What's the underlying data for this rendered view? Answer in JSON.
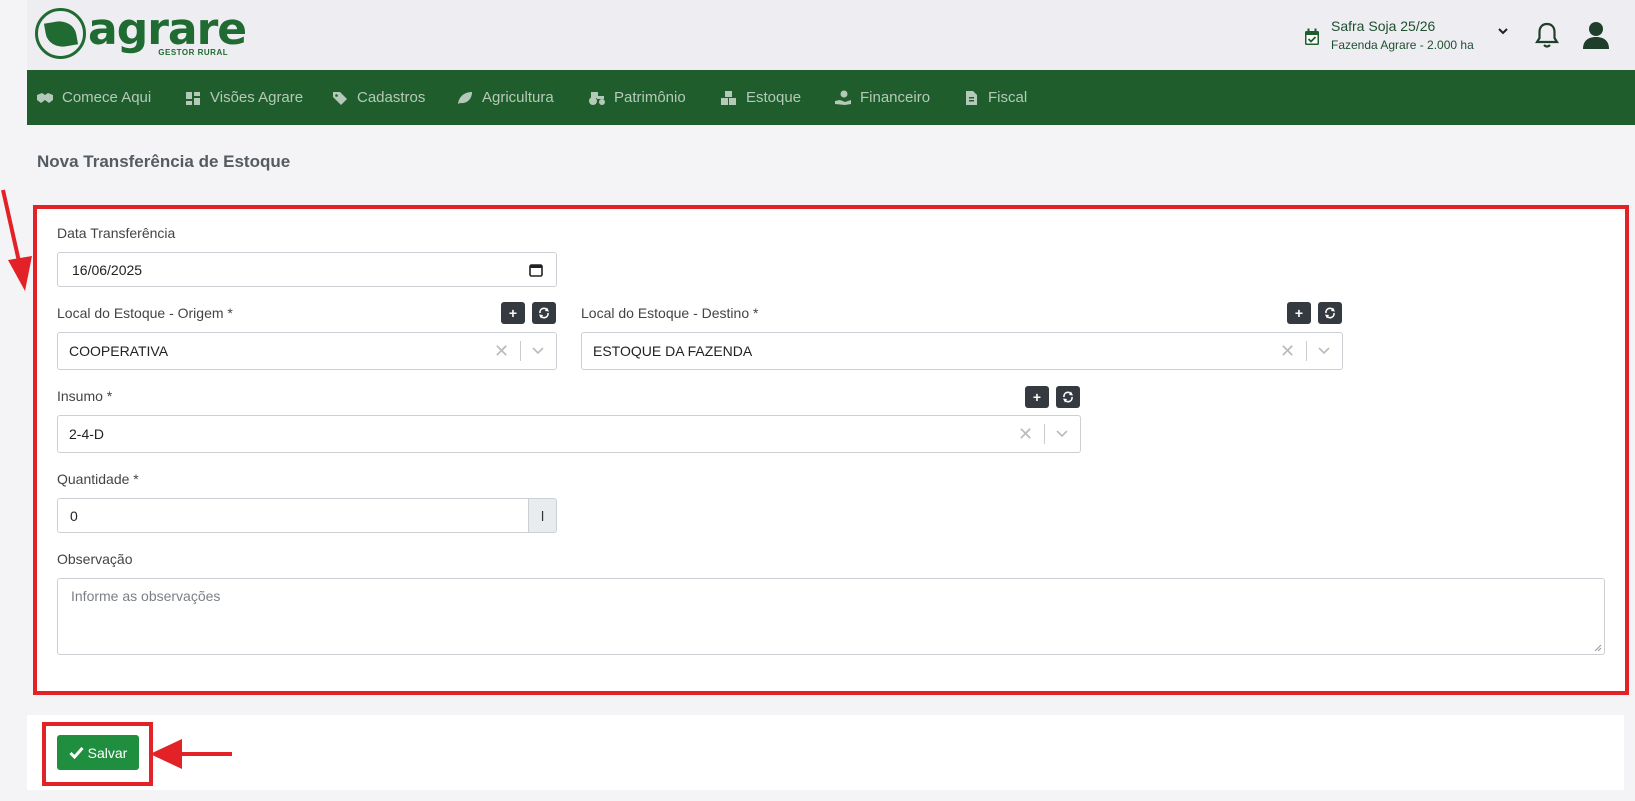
{
  "header": {
    "logo_text": "agrare",
    "logo_subtitle": "GESTOR RURAL",
    "safra_title": "Safra Soja 25/26",
    "safra_subtitle": "Fazenda Agrare - 2.000 ha"
  },
  "nav": {
    "items": [
      {
        "label": "Comece Aqui",
        "icon": "handshake-icon"
      },
      {
        "label": "Visões Agrare",
        "icon": "dashboard-icon"
      },
      {
        "label": "Cadastros",
        "icon": "tag-icon"
      },
      {
        "label": "Agricultura",
        "icon": "leaf-icon"
      },
      {
        "label": "Patrimônio",
        "icon": "tractor-icon"
      },
      {
        "label": "Estoque",
        "icon": "boxes-icon"
      },
      {
        "label": "Financeiro",
        "icon": "hand-money-icon"
      },
      {
        "label": "Fiscal",
        "icon": "file-invoice-icon"
      }
    ]
  },
  "page": {
    "title": "Nova Transferência de Estoque"
  },
  "form": {
    "data_label": "Data Transferência",
    "data_value": "16/06/2025",
    "origem_label": "Local do Estoque - Origem *",
    "origem_value": "COOPERATIVA",
    "destino_label": "Local do Estoque - Destino *",
    "destino_value": "ESTOQUE DA FAZENDA",
    "insumo_label": "Insumo *",
    "insumo_value": "2-4-D",
    "quantidade_label": "Quantidade *",
    "quantidade_value": "0",
    "quantidade_unit": "l",
    "obs_label": "Observação",
    "obs_placeholder": "Informe as observações"
  },
  "footer": {
    "save_label": "Salvar"
  },
  "colors": {
    "nav_bg": "#1f5e2c",
    "brand": "#1f6b32",
    "highlight": "#e32228",
    "save": "#1f8e3f"
  }
}
